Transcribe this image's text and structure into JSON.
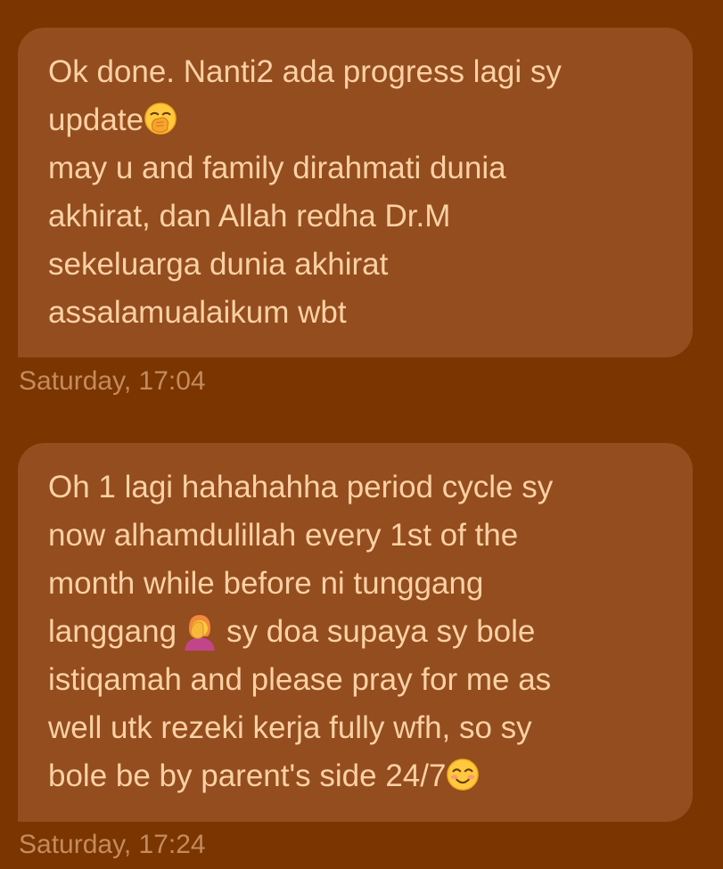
{
  "messages": [
    {
      "lines": [
        "Ok done. Nanti2 ada progress lagi sy",
        "update",
        "may u and family dirahmati dunia",
        "akhirat, dan Allah redha Dr.M",
        "sekeluarga dunia akhirat",
        "assalamualaikum wbt"
      ],
      "emoji": [
        "hand-over-mouth-emoji"
      ],
      "timestamp": "Saturday, 17:04"
    },
    {
      "lines": [
        "Oh 1 lagi hahahahha period cycle sy",
        "now alhamdulillah every 1st of the",
        "month while before ni tunggang",
        "langgang",
        "sy doa supaya sy bole",
        "istiqamah and please pray for me as",
        "well utk rezeki kerja fully wfh, so sy",
        "bole be by parent's side 24/7"
      ],
      "emoji": [
        "facepalm-emoji",
        "smiling-blush-emoji"
      ],
      "timestamp": "Saturday, 17:24"
    }
  ],
  "colors": {
    "background": "#7a3500",
    "bubble": "#944d1e",
    "message_text": "#fbd1a5",
    "timestamp_text": "#c58b5c"
  }
}
